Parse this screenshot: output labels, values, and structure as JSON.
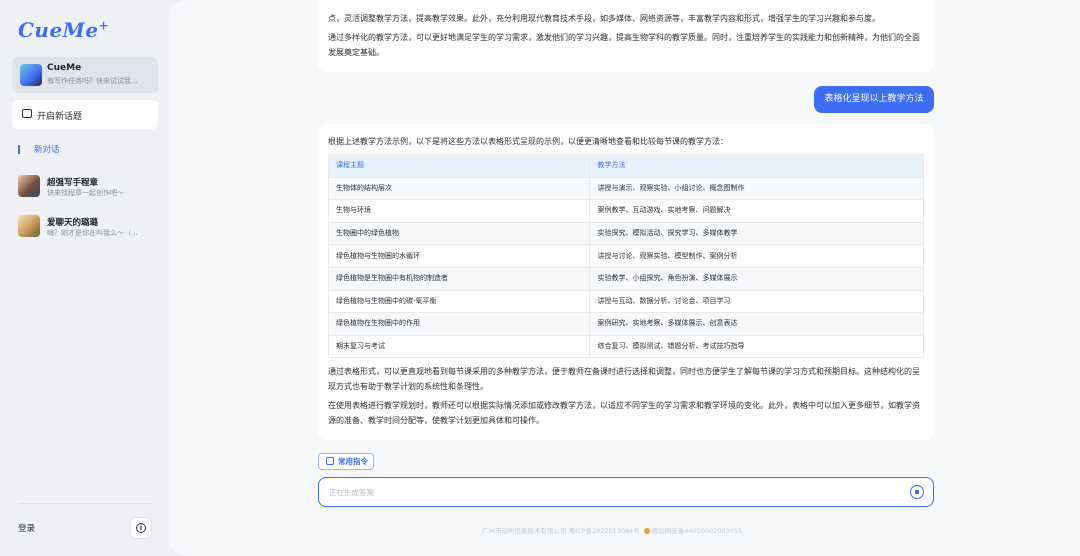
{
  "brand": {
    "logo_text": "CueMe",
    "logo_plus": "+"
  },
  "sidebar": {
    "bot_card": {
      "title": "CueMe",
      "subtitle": "有写作任务吗？快来试试我..."
    },
    "new_topic_label": "开启新话题",
    "new_chat_label": "新对话",
    "chats": [
      {
        "title": "超强写手程章",
        "subtitle": "快来找程章一起创作吧～"
      },
      {
        "title": "爱聊天的璐璐",
        "subtitle": "嗨？刚才是你在叫我么～（..."
      }
    ],
    "login_label": "登录",
    "info_icon": "info-icon"
  },
  "conversation": {
    "msg1_paragraphs": [
      "点，灵活调整教学方法，提高教学效果。此外，充分利用现代教育技术手段，如多媒体、网络资源等，丰富教学内容和形式，增强学生的学习兴趣和参与度。",
      "通过多样化的教学方法，可以更好地满足学生的学习需求，激发他们的学习兴趣，提高生物学科的教学质量。同时，注重培养学生的实践能力和创新精神，为他们的全面发展奠定基础。"
    ],
    "user_message": "表格化呈现以上教学方法",
    "reply_intro": "根据上述教学方法示例，以下是将这些方法以表格形式呈现的示例，以便更清晰地查看和比较每节课的教学方法：",
    "table": {
      "headers": [
        "课程主题",
        "教学方法"
      ],
      "rows": [
        [
          "生物体的结构层次",
          "讲授与演示、观察实验、小组讨论、概念图制作"
        ],
        [
          "生物与环境",
          "案例教学、互动游戏、实地考察、问题解决"
        ],
        [
          "生物圈中的绿色植物",
          "实验探究、模拟活动、探究学习、多媒体教学"
        ],
        [
          "绿色植物与生物圈的水循环",
          "讲授与讨论、观察实验、模型制作、案例分析"
        ],
        [
          "绿色植物是生物圈中有机物的制造者",
          "实验教学、小组探究、角色扮演、多媒体展示"
        ],
        [
          "绿色植物与生物圈中的碳-氧平衡",
          "讲授与互动、数据分析、讨论会、项目学习"
        ],
        [
          "绿色植物在生物圈中的作用",
          "案例研究、实地考察、多媒体展示、创意表达"
        ],
        [
          "期末复习与考试",
          "综合复习、模拟测试、错题分析、考试技巧指导"
        ]
      ]
    },
    "reply_paragraphs": [
      "通过表格形式，可以更直观地看到每节课采用的多种教学方法，便于教师在备课时进行选择和调整，同时也方便学生了解每节课的学习方式和预期目标。这种结构化的呈现方式也有助于教学计划的系统性和条理性。",
      "在使用表格进行教学规划时，教师还可以根据实际情况添加或修改教学方法，以适应不同学生的学习需求和教学环境的变化。此外，表格中可以加入更多细节，如教学资源的准备、教学时间分配等，使教学计划更加具体和可操作。"
    ]
  },
  "composer": {
    "common_commands_label": "常用指令",
    "input_placeholder": "正在生成答案",
    "input_value": ""
  },
  "footer": {
    "company": "广州市动吩信息技术有限公司 粤ICP备2022013084号",
    "police": "粤公网安备44010502003055"
  },
  "colors": {
    "accent": "#3d6df2",
    "table_header_bg": "#e7f1fb"
  }
}
